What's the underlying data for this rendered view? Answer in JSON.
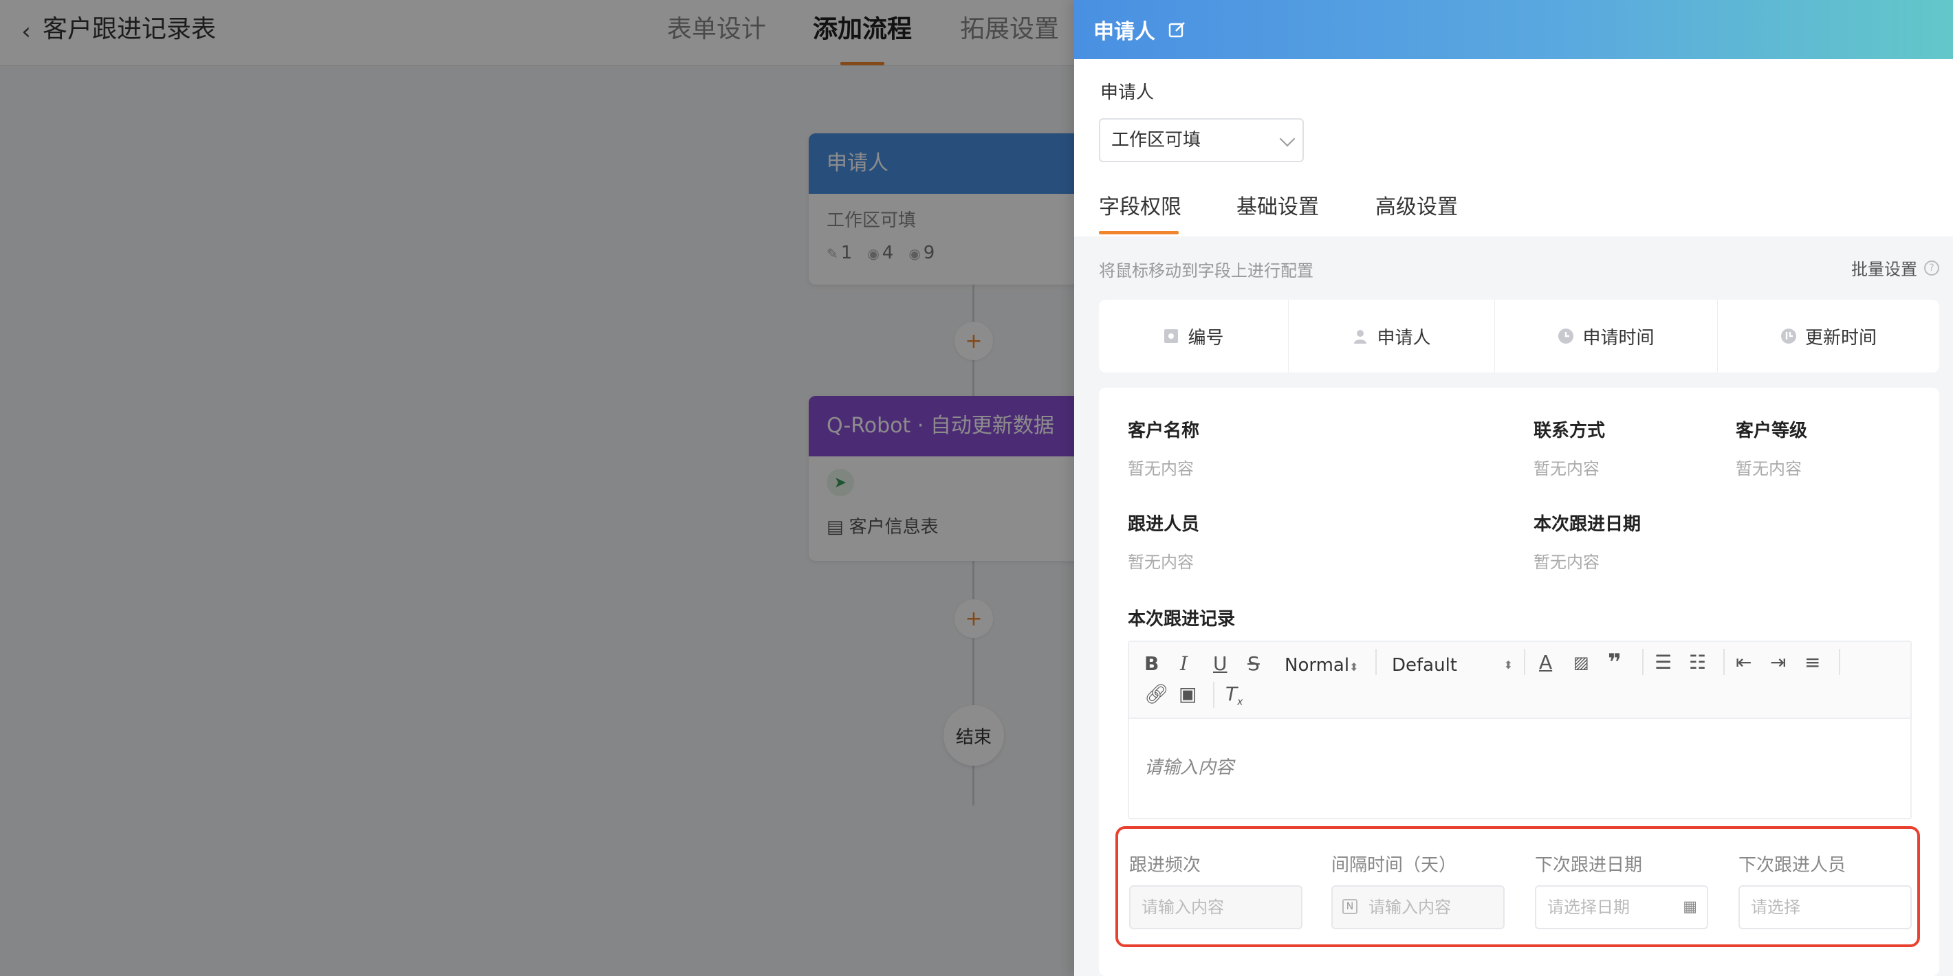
{
  "header": {
    "back_icon": "chevron-left-icon",
    "title": "客户跟进记录表",
    "tabs": [
      "表单设计",
      "添加流程",
      "拓展设置"
    ],
    "active_tab": "添加流程"
  },
  "flow": {
    "node1": {
      "title": "申请人",
      "subtitle": "工作区可填",
      "stats": [
        "1",
        "4",
        "9"
      ]
    },
    "node2": {
      "title": "Q-Robot · 自动更新数据",
      "table": "客户信息表"
    },
    "end": "结束",
    "plus": "+"
  },
  "panel": {
    "title": "申请人",
    "section_label": "申请人",
    "select_value": "工作区可填",
    "tabs": [
      "字段权限",
      "基础设置",
      "高级设置"
    ],
    "hint": "将鼠标移动到字段上进行配置",
    "batch": "批量设置",
    "batch_help": "?",
    "system_fields": [
      "编号",
      "申请人",
      "申请时间",
      "更新时间"
    ],
    "fields": [
      {
        "label": "客户名称",
        "value": "暂无内容"
      },
      {
        "label": "联系方式",
        "value": "暂无内容"
      },
      {
        "label": "客户等级",
        "value": "暂无内容"
      },
      {
        "label": "跟进人员",
        "value": "暂无内容"
      },
      {
        "label": "本次跟进日期",
        "value": "暂无内容"
      }
    ],
    "editor": {
      "label": "本次跟进记录",
      "heading_select": "Normal",
      "font_select": "Default",
      "placeholder": "请输入内容"
    },
    "bottom_fields": [
      {
        "label": "跟进频次",
        "placeholder": "请输入内容"
      },
      {
        "label": "间隔时间（天）",
        "placeholder": "请输入内容"
      },
      {
        "label": "下次跟进日期",
        "placeholder": "请选择日期"
      },
      {
        "label": "下次跟进人员",
        "placeholder": "请选择"
      }
    ]
  },
  "colors": {
    "accent": "#f0852d",
    "header_gradient_start": "#4a90e2",
    "header_gradient_end": "#63c7c9",
    "node_applicant": "#4a90e2",
    "node_robot": "#8a4fd6",
    "highlight": "#e8412f"
  }
}
